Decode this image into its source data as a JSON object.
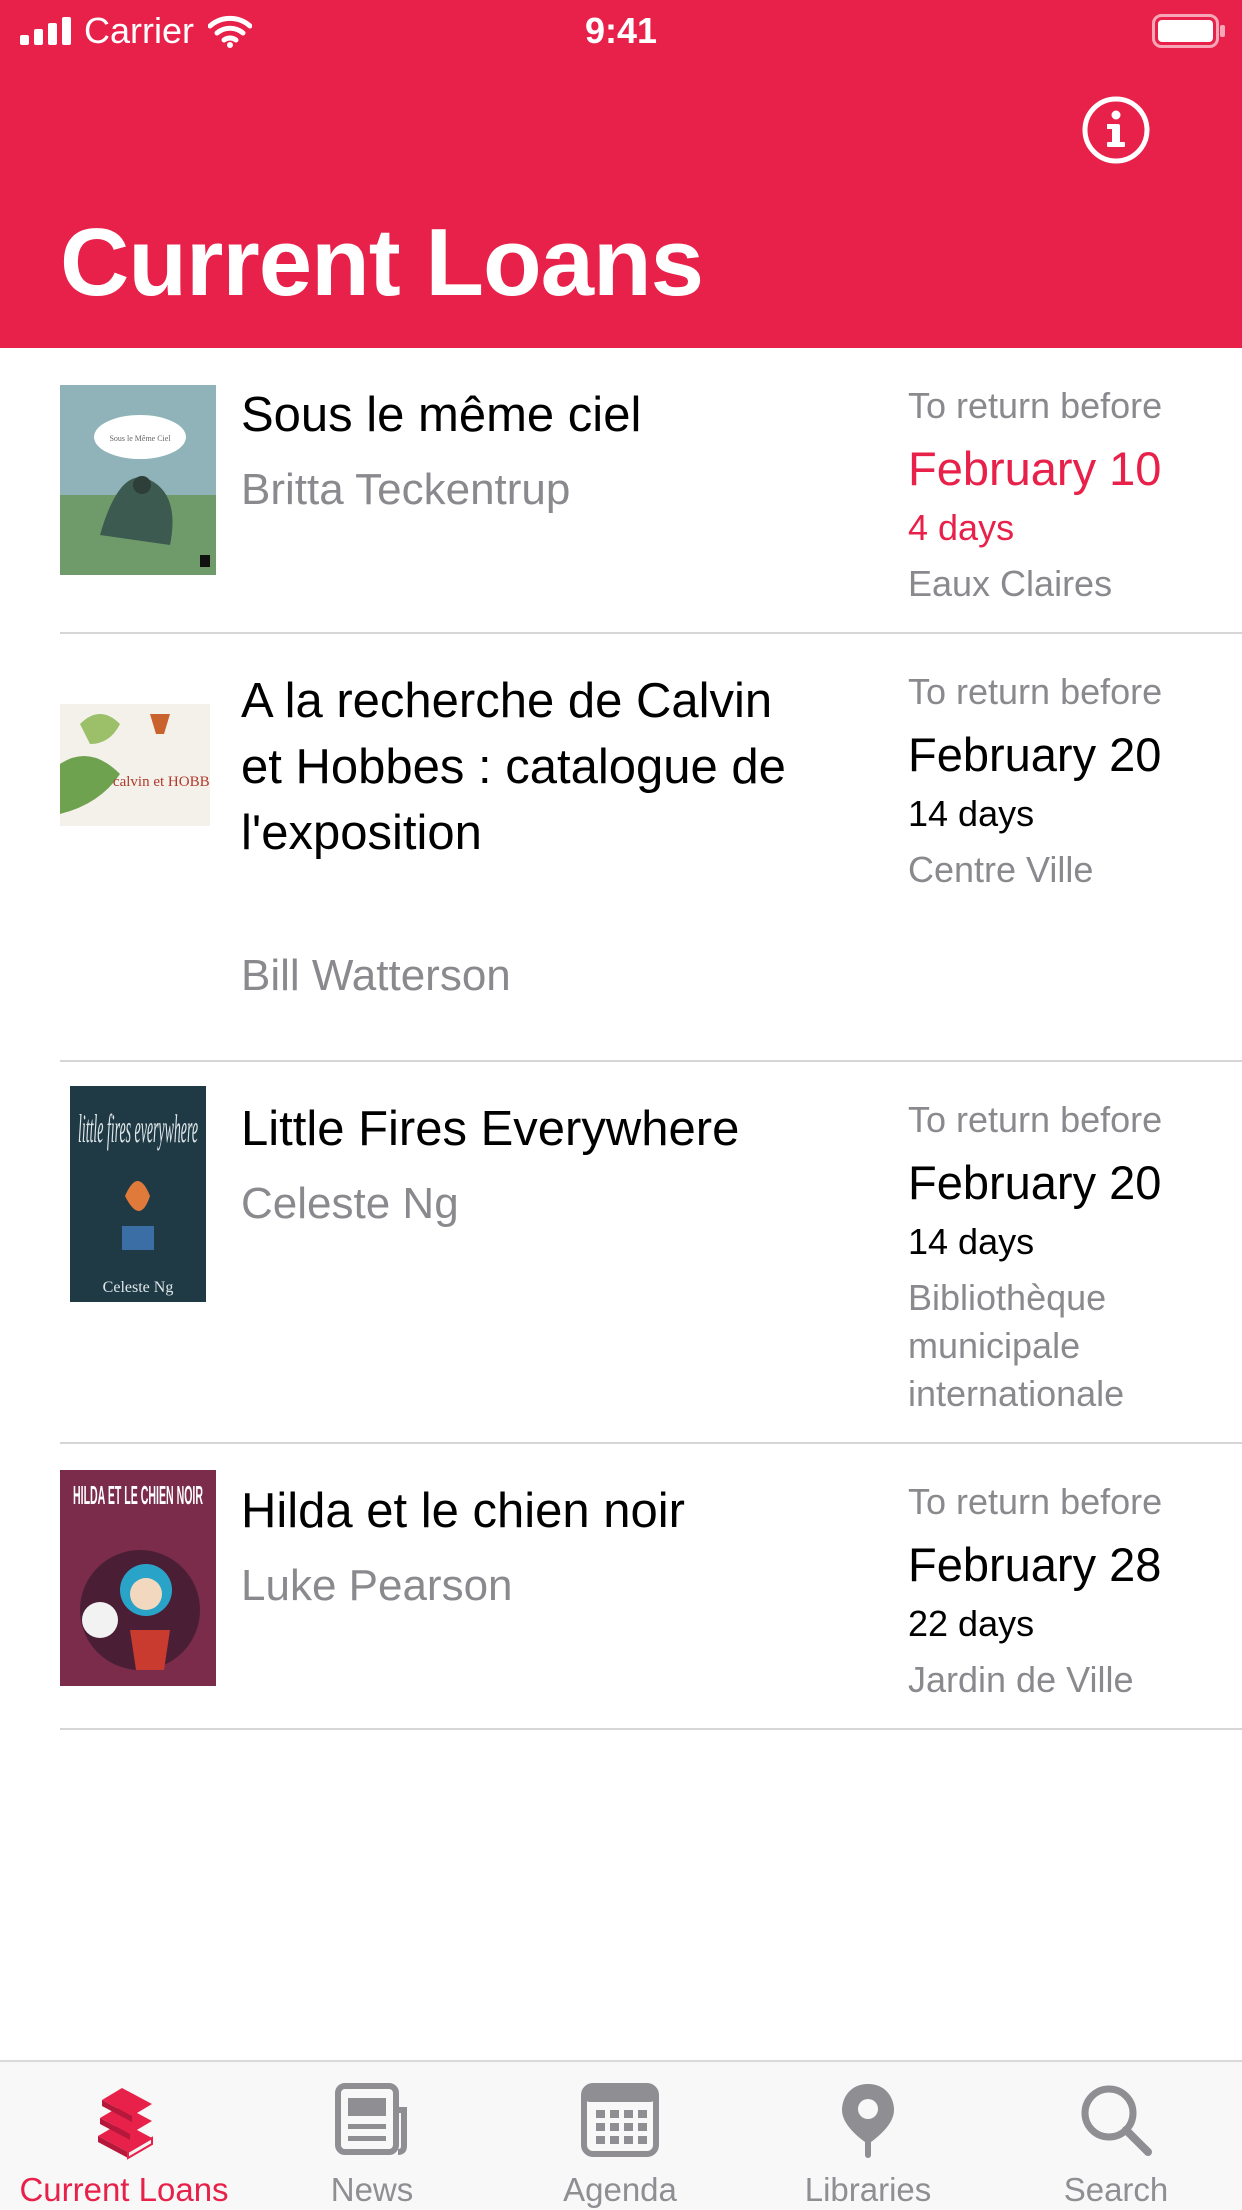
{
  "status_bar": {
    "carrier": "Carrier",
    "time": "9:41"
  },
  "header": {
    "title": "Current Loans",
    "info_icon": "info-circle-icon",
    "background_color": "#e8214a"
  },
  "loans": [
    {
      "title": "Sous le même ciel",
      "author": "Britta Teckentrup",
      "due_label": "To return before",
      "due_date": "February 10",
      "days_left": "4 days",
      "library": "Eaux Claires",
      "urgent": true,
      "cover_title": "Sous le Même Ciel"
    },
    {
      "title": "A la recherche de Calvin et Hobbes : catalogue de l'exposition",
      "author": "Bill Watterson",
      "due_label": "To return before",
      "due_date": "February 20",
      "days_left": "14 days",
      "library": "Centre Ville",
      "urgent": false,
      "cover_title": "calvin et HOBBES"
    },
    {
      "title": "Little Fires Everywhere",
      "author": "Celeste Ng",
      "due_label": "To return before",
      "due_date": "February 20",
      "days_left": "14 days",
      "library": "Bibliothèque municipale internationale",
      "urgent": false,
      "cover_title": "little fires everywhere",
      "cover_author": "Celeste Ng"
    },
    {
      "title": "Hilda et le chien noir",
      "author": "Luke Pearson",
      "due_label": "To return before",
      "due_date": "February 28",
      "days_left": "22 days",
      "library": "Jardin de Ville",
      "urgent": false,
      "cover_title": "HILDA ET LE CHIEN NOIR"
    }
  ],
  "tab_bar": {
    "active_color": "#e8214a",
    "inactive_color": "#8e8e93",
    "tabs": [
      {
        "label": "Current Loans",
        "icon": "books-stack-icon",
        "active": true
      },
      {
        "label": "News",
        "icon": "newspaper-icon",
        "active": false
      },
      {
        "label": "Agenda",
        "icon": "calendar-icon",
        "active": false
      },
      {
        "label": "Libraries",
        "icon": "map-pin-icon",
        "active": false
      },
      {
        "label": "Search",
        "icon": "magnifier-icon",
        "active": false
      }
    ]
  }
}
